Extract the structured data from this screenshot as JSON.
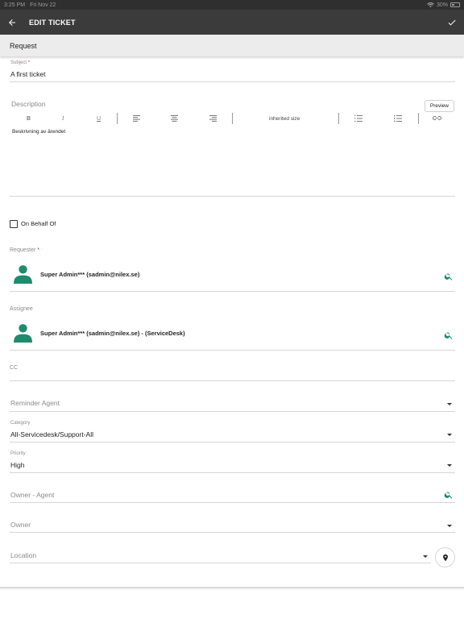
{
  "status_bar": {
    "time": "3:25 PM",
    "date": "Fri Nov 22",
    "battery": "30%"
  },
  "app_bar": {
    "title": "EDIT TICKET"
  },
  "section": {
    "title": "Request"
  },
  "subject": {
    "label": "Subject",
    "required_mark": "*",
    "value": "A first ticket"
  },
  "description": {
    "label": "Description",
    "preview_label": "Preview",
    "toolbar": {
      "bold": "B",
      "italic": "I",
      "underline": "U",
      "size": "inherited size"
    },
    "text": "Beskrivning av ärendet"
  },
  "on_behalf_of": {
    "label": "On Behalf Of",
    "checked": false
  },
  "requester": {
    "label": "Requester",
    "required_mark": "*",
    "name": "Super Admin*** (sadmin@nilex.se)"
  },
  "assignee": {
    "label": "Assignee",
    "name": "Super Admin*** (sadmin@nilex.se) - (ServiceDesk)"
  },
  "cc": {
    "label": "CC"
  },
  "reminder_agent": {
    "placeholder": "Reminder Agent"
  },
  "category": {
    "label": "Category",
    "value": "All-Servicedesk/Support-All"
  },
  "priority": {
    "label": "Priority",
    "value": "High"
  },
  "owner_agent": {
    "placeholder": "Owner - Agent"
  },
  "owner": {
    "placeholder": "Owner"
  },
  "location": {
    "placeholder": "Location"
  },
  "colors": {
    "accent": "#1e8a6e",
    "appbar": "#3b3b3b",
    "required": "#d32f2f"
  }
}
